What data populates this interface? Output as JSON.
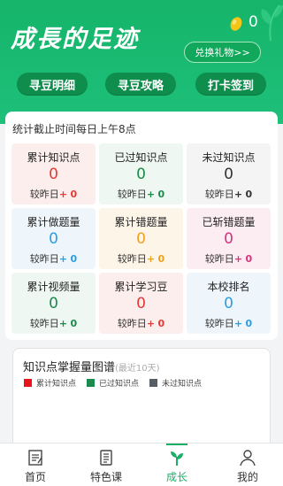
{
  "header": {
    "title": "成長的足迹",
    "bean_count": "0",
    "redeem_label": "兑换礼物>>",
    "pills": [
      "寻豆明细",
      "寻豆攻略",
      "打卡签到"
    ]
  },
  "stats": {
    "note": "统计截止时间每日上午8点",
    "delta_prefix": "较昨日",
    "cells": [
      {
        "label": "累计知识点",
        "value": "0",
        "sign": "+",
        "delta": "0",
        "value_color": "#e53935",
        "delta_color": "#e53935",
        "bg": "#fdeeee"
      },
      {
        "label": "已过知识点",
        "value": "0",
        "sign": "+",
        "delta": "0",
        "value_color": "#1b8a4c",
        "delta_color": "#1b8a4c",
        "bg": "#eef7f1"
      },
      {
        "label": "未过知识点",
        "value": "0",
        "sign": "+",
        "delta": "0",
        "value_color": "#333333",
        "delta_color": "#333333",
        "bg": "#f4f4f4"
      },
      {
        "label": "累计做题量",
        "value": "0",
        "sign": "+",
        "delta": "0",
        "value_color": "#2b9de0",
        "delta_color": "#2b9de0",
        "bg": "#eef6fc"
      },
      {
        "label": "累计错题量",
        "value": "0",
        "sign": "+",
        "delta": "0",
        "value_color": "#f0a11c",
        "delta_color": "#f0a11c",
        "bg": "#fdf5e8"
      },
      {
        "label": "已斩错题量",
        "value": "0",
        "sign": "+",
        "delta": "0",
        "value_color": "#d6337a",
        "delta_color": "#d6337a",
        "bg": "#fcedf3"
      },
      {
        "label": "累计视频量",
        "value": "0",
        "sign": "+",
        "delta": "0",
        "value_color": "#1b8a4c",
        "delta_color": "#1b8a4c",
        "bg": "#eef7f1"
      },
      {
        "label": "累计学习豆",
        "value": "0",
        "sign": "+",
        "delta": "0",
        "value_color": "#e53935",
        "delta_color": "#e53935",
        "bg": "#fdeeee"
      },
      {
        "label": "本校排名",
        "value": "0",
        "sign": "+",
        "delta": "0",
        "value_color": "#2b9de0",
        "delta_color": "#2b9de0",
        "bg": "#eef6fc"
      }
    ]
  },
  "chart": {
    "title": "知识点掌握量图谱",
    "subtitle": "(最近10天)",
    "legend": [
      {
        "label": "累计知识点",
        "color": "#e8141c"
      },
      {
        "label": "已过知识点",
        "color": "#1b8a4c"
      },
      {
        "label": "未过知识点",
        "color": "#555d66"
      }
    ]
  },
  "tabs": [
    {
      "label": "首页",
      "icon": "home-icon",
      "active": false
    },
    {
      "label": "特色课",
      "icon": "course-icon",
      "active": false
    },
    {
      "label": "成长",
      "icon": "growth-icon",
      "active": true
    },
    {
      "label": "我的",
      "icon": "profile-icon",
      "active": false
    }
  ]
}
